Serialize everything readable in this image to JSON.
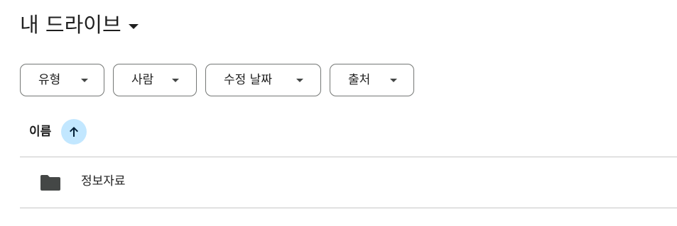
{
  "header": {
    "title": "내 드라이브",
    "title_dropdown_icon": "caret-down-icon"
  },
  "filters": [
    {
      "label": "유형",
      "icon": "caret-down-icon"
    },
    {
      "label": "사람",
      "icon": "caret-down-icon"
    },
    {
      "label": "수정 날짜",
      "icon": "caret-down-icon"
    },
    {
      "label": "출처",
      "icon": "caret-down-icon"
    }
  ],
  "list_header": {
    "name_label": "이름",
    "sort_icon": "arrow-up-icon",
    "sort_direction": "ascending"
  },
  "files": [
    {
      "name": "정보자료",
      "icon": "folder-icon"
    }
  ],
  "colors": {
    "text": "#1f1f1f",
    "chip_border": "#747775",
    "sort_bg": "#c2e7ff",
    "sort_arrow": "#001d35",
    "divider": "#c7c7c7",
    "folder": "#444746"
  }
}
